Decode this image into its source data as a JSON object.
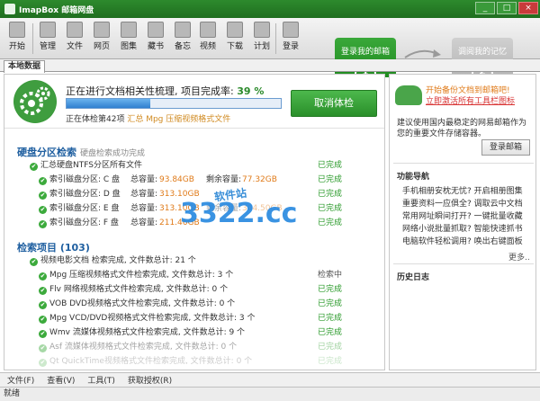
{
  "window": {
    "title": "ImapBox 邮箱网盘",
    "controls": [
      "_",
      "□",
      "×"
    ]
  },
  "toolbar": {
    "items": [
      "开始",
      "管理",
      "文件",
      "网页",
      "图集",
      "藏书",
      "备忘",
      "视频",
      "下载",
      "计划",
      "登录"
    ],
    "steps": [
      {
        "label": "登录我的邮箱",
        "number": "1"
      },
      {
        "label": "调阅我的记忆",
        "number": "2"
      }
    ]
  },
  "tabs": {
    "local": "本地数据"
  },
  "status": {
    "running_text": "正在进行文档相关性梳理, 项目完成率:",
    "percent_text": "39 %",
    "progress": 0.39,
    "checking_prefix": "正在体检第42项",
    "checking_file": "汇总 Mpg 压缩视频格式文件",
    "cancel_label": "取消体检"
  },
  "disk": {
    "title": "硬盘分区检索",
    "subtitle": "硬盘检索成功完成",
    "summary": "汇总硬盘NTFS分区所有文件",
    "summary_state": "已完成",
    "total_label": "总容量:",
    "free_label": "剩余容量:",
    "partitions": [
      {
        "label": "索引磁盘分区: C 盘",
        "total": "93.84GB",
        "free": "77.32GB",
        "state": "已完成"
      },
      {
        "label": "索引磁盘分区: D 盘",
        "total": "313.10GB",
        "free": "",
        "state": "已完成"
      },
      {
        "label": "索引磁盘分区: E 盘",
        "total": "313.10GB",
        "free": "304.50GB",
        "state": "已完成"
      },
      {
        "label": "索引磁盘分区: F 盘",
        "total": "211.46GB",
        "free": "",
        "state": "已完成"
      }
    ]
  },
  "search": {
    "title": "检索项目 (103)",
    "items": [
      {
        "text": "视频电影文档 检索完成, 文件数总计: 21 个",
        "state": ""
      },
      {
        "text": "Mpg 压缩视频格式文件检索完成, 文件数总计: 3 个",
        "state": "检索中"
      },
      {
        "text": "Flv 网络视频格式文件检索完成, 文件数总计: 0 个",
        "state": "已完成"
      },
      {
        "text": "VOB DVD视频格式文件检索完成, 文件数总计: 0 个",
        "state": "已完成"
      },
      {
        "text": "Mpg VCD/DVD视频格式文件检索完成, 文件数总计: 3 个",
        "state": "已完成"
      },
      {
        "text": "Wmv 流媒体视频格式文件检索完成, 文件数总计: 9 个",
        "state": "已完成"
      },
      {
        "text": "Asf 流媒体视频格式文件检索完成, 文件数总计: 0 个",
        "state": "已完成"
      },
      {
        "text": "Qt QuickTime视频格式文件检索完成, 文件数总计: 0 个",
        "state": "已完成"
      }
    ]
  },
  "watermark": {
    "logo": "3322.cc",
    "tag": "软件站"
  },
  "sidebar": {
    "promo_line1": "开始备份文档到邮箱吧!",
    "promo_line2": "立即激活所有工具栏图标",
    "description": "建议使用国内最稳定的网易邮箱作为您的重要文件存储容器。",
    "login_label": "登录邮箱",
    "nav_title": "功能导航",
    "links": [
      "手机相册安枕无忧? 开启相册图集",
      "重要资料一应俱全? 调取云中文档",
      "常用网址瞬间打开? 一键批量收藏",
      "网络小说批量抓取? 智能快速抓书",
      "电脑软件轻松调用? 唤出右键面板"
    ],
    "more": "更多..",
    "history_title": "历史日志"
  },
  "menu": {
    "items": [
      "文件(F)",
      "查看(V)",
      "工具(T)",
      "获取授权(R)"
    ]
  },
  "statusbar": {
    "text": "就绪"
  },
  "colors": {
    "brand_green": "#2d8a2d",
    "section_blue": "#1f5fa0",
    "accent_orange": "#e07b1a",
    "done_green": "#2a9a2a"
  }
}
